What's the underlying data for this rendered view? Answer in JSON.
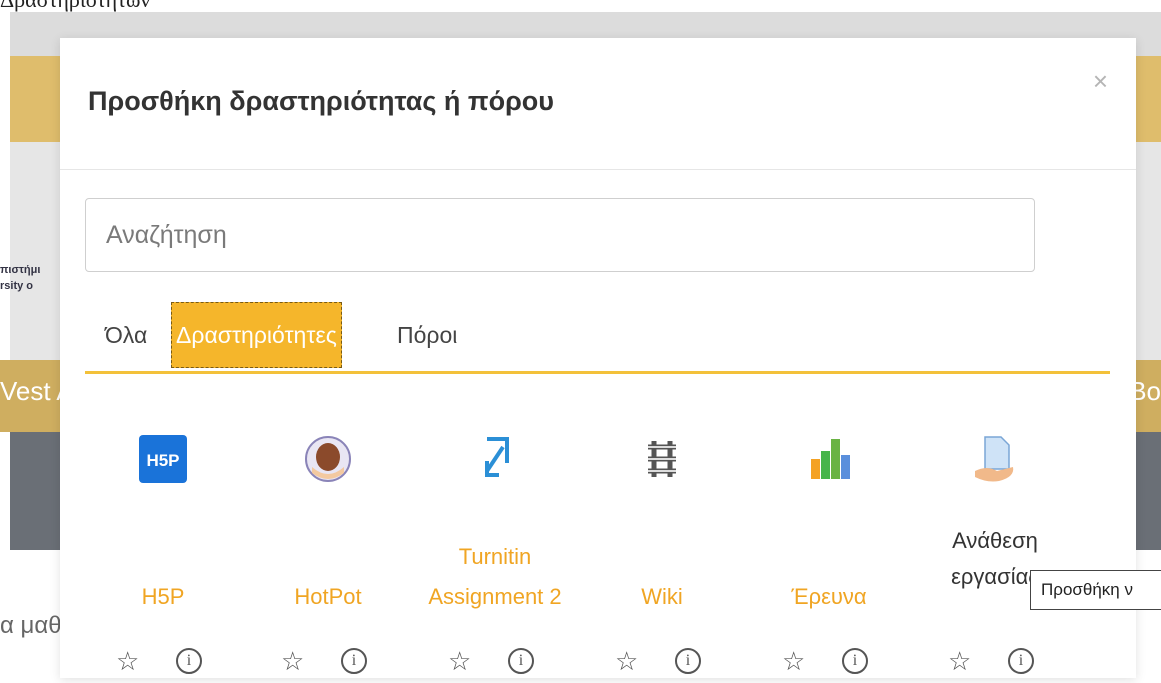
{
  "background": {
    "top_heading": "Δραστηριοτήτων",
    "logo_text_line1": "πιστήμι",
    "logo_text_line2": "rsity o",
    "band_left": "Vest A",
    "band_right": "Bo",
    "bottom_text": "α μαθ"
  },
  "modal": {
    "title": "Προσθήκη δραστηριότητας ή πόρου",
    "close_symbol": "×",
    "search": {
      "placeholder": "Αναζήτηση",
      "value": ""
    },
    "tabs": [
      {
        "label": "Όλα",
        "active": false
      },
      {
        "label": "Δραστηριότητες",
        "active": true
      },
      {
        "label": "Πόροι",
        "active": false
      }
    ],
    "items": [
      {
        "icon": "h5p-icon",
        "label_line1": "",
        "label_line2": "H5P"
      },
      {
        "icon": "hotpot-icon",
        "label_line1": "",
        "label_line2": "HotPot"
      },
      {
        "icon": "turnitin-icon",
        "label_line1": "Turnitin",
        "label_line2": "Assignment 2"
      },
      {
        "icon": "wiki-icon",
        "label_line1": "",
        "label_line2": "Wiki"
      },
      {
        "icon": "survey-icon",
        "label_line1": "",
        "label_line2": "Έρευνα"
      },
      {
        "icon": "assignment-icon",
        "label_line1": "Ανάθεση",
        "label_line2": "εργασίας"
      }
    ],
    "tooltip": "Προσθήκη ν"
  },
  "colors": {
    "accent": "#f5b62b",
    "link": "#f0a523",
    "gold_band": "#dfbd6c",
    "dark_band": "#6a6f76"
  }
}
